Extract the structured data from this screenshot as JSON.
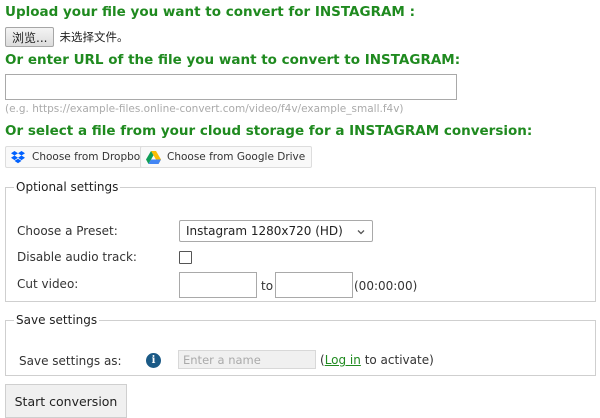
{
  "upload": {
    "heading": "Upload your file you want to convert for INSTAGRAM :",
    "browse_label": "浏览...",
    "file_status": "未选择文件。"
  },
  "url": {
    "heading": "Or enter URL of the file you want to convert to INSTAGRAM:",
    "value": "",
    "example": "(e.g. https://example-files.online-convert.com/video/f4v/example_small.f4v)"
  },
  "cloud": {
    "heading": "Or select a file from your cloud storage for a INSTAGRAM conversion:",
    "dropbox_label": "Choose from Dropbox",
    "gdrive_label": "Choose from Google Drive"
  },
  "optional": {
    "legend": "Optional settings",
    "preset_label": "Choose a Preset:",
    "preset_value": "Instagram 1280x720 (HD)",
    "audio_label": "Disable audio track:",
    "audio_checked": false,
    "cut_label": "Cut video:",
    "cut_from": "",
    "cut_to_word": "to",
    "cut_to": "",
    "cut_format": "(00:00:00)"
  },
  "save": {
    "legend": "Save settings",
    "label": "Save settings as:",
    "info_glyph": "i",
    "name_placeholder": "Enter a name",
    "activate_prefix": "(",
    "login_label": "Log in",
    "activate_suffix": " to activate)"
  },
  "start_label": "Start conversion",
  "colors": {
    "heading": "#1f8a1f",
    "dropbox": "#0061ff",
    "info": "#1b5a86"
  }
}
